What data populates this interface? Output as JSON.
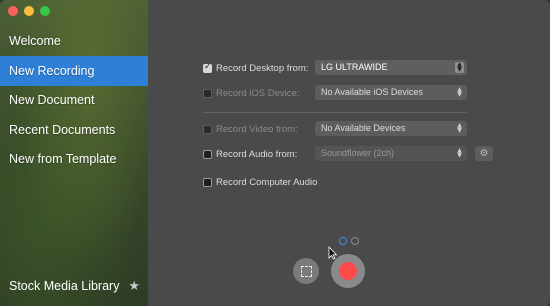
{
  "sidebar": {
    "items": [
      {
        "label": "Welcome"
      },
      {
        "label": "New Recording"
      },
      {
        "label": "New Document"
      },
      {
        "label": "Recent Documents"
      },
      {
        "label": "New from Template"
      }
    ],
    "footer_label": "Stock Media Library",
    "footer_icon": "star-icon"
  },
  "options": {
    "desktop": {
      "label": "Record Desktop from:",
      "value": "LG ULTRAWIDE",
      "checked": true
    },
    "ios": {
      "label": "Record iOS Device:",
      "value": "No Available iOS Devices",
      "checked": false
    },
    "video": {
      "label": "Record Video from:",
      "value": "No Available Devices",
      "checked": false
    },
    "audio": {
      "label": "Record Audio from:",
      "value": "Soundflower (2ch)",
      "checked": false
    },
    "computer_audio": {
      "label": "Record Computer Audio",
      "checked": false
    }
  },
  "colors": {
    "selected": "#2e7fd6",
    "record": "#ff4a4a",
    "page_active": "#3a8ee6"
  }
}
